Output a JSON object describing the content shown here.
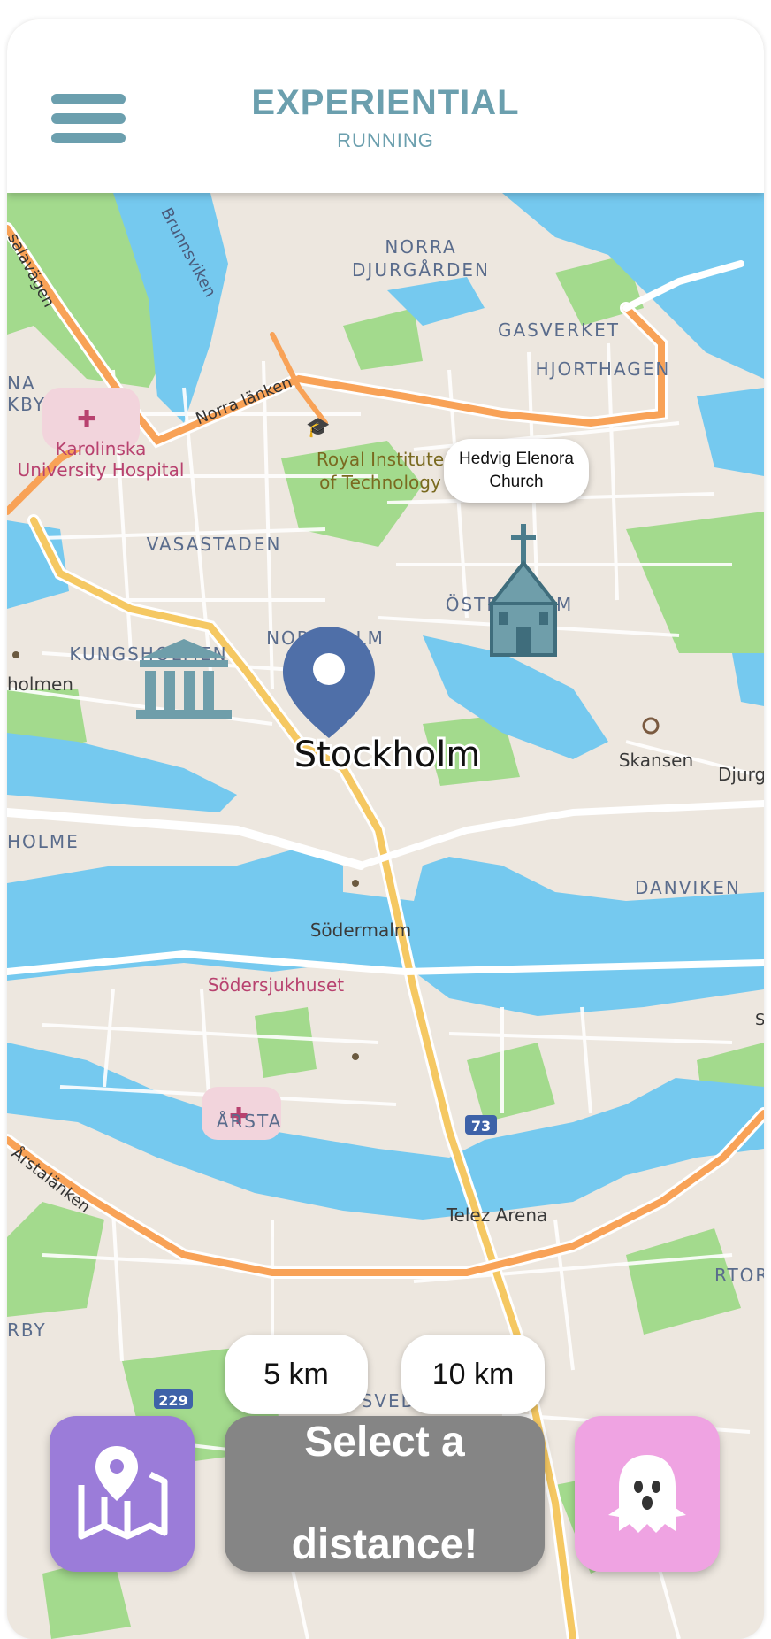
{
  "header": {
    "title": "EXPERIENTIAL",
    "subtitle": "RUNNING"
  },
  "map": {
    "city_label": "Stockholm",
    "church_popup": "Hedvig Elenora Church",
    "labels": {
      "norra_djurgarden_1": "NORRA",
      "norra_djurgarden_2": "DJURGÅRDEN",
      "gasverket": "GASVERKET",
      "hjorthagen": "HJORTHAGEN",
      "brunnsviken": "Brunnsviken",
      "norra_lanken": "Norra länken",
      "salavagen": "salavägen",
      "na": "NA",
      "kby": "KBY",
      "karolinska_1": "Karolinska",
      "karolinska_2": "University Hospital",
      "royal_1": "Royal Institute",
      "royal_2": "of Technology",
      "vasastaden": "VASASTADEN",
      "ostermalm": "ÖSTERMALM",
      "norrmalm": "NORRMALM",
      "kungsholmen": "KUNGSHOLMEN",
      "holmen": "holmen",
      "skansen": "Skansen",
      "djurg": "Djurg",
      "holme": "HOLME",
      "danviken": "DANVIKEN",
      "sodermalm": "Södermalm",
      "sodersjukhuset": "Södersjukhuset",
      "arstalanken": "Årstalänken",
      "arsta": "ÅRSTA",
      "route_73": "73",
      "telez": "Telez Arena",
      "rby": "RBY",
      "rtor": "RTOR",
      "route_229": "229",
      "svedmyra": "SVEDMYRA",
      "s": "S"
    }
  },
  "distances": {
    "five": "5 km",
    "ten": "10 km"
  },
  "actions": {
    "select_line1": "Select a",
    "select_line2": "distance!"
  },
  "icons": {
    "menu": "hamburger-menu-icon",
    "map": "map-icon",
    "ghost": "ghost-icon",
    "pin": "location-pin-icon",
    "church": "church-icon",
    "museum": "museum-icon"
  },
  "colors": {
    "brand": "#6b9fae",
    "map_button": "#9b7cd9",
    "ghost_button": "#efa3e2",
    "select_button": "#858585",
    "pin": "#4f6fa8",
    "water": "#75c9ef",
    "park": "#9fd98c",
    "land": "#ede7df",
    "major_road": "#f8a257",
    "highway": "#f5c862"
  }
}
